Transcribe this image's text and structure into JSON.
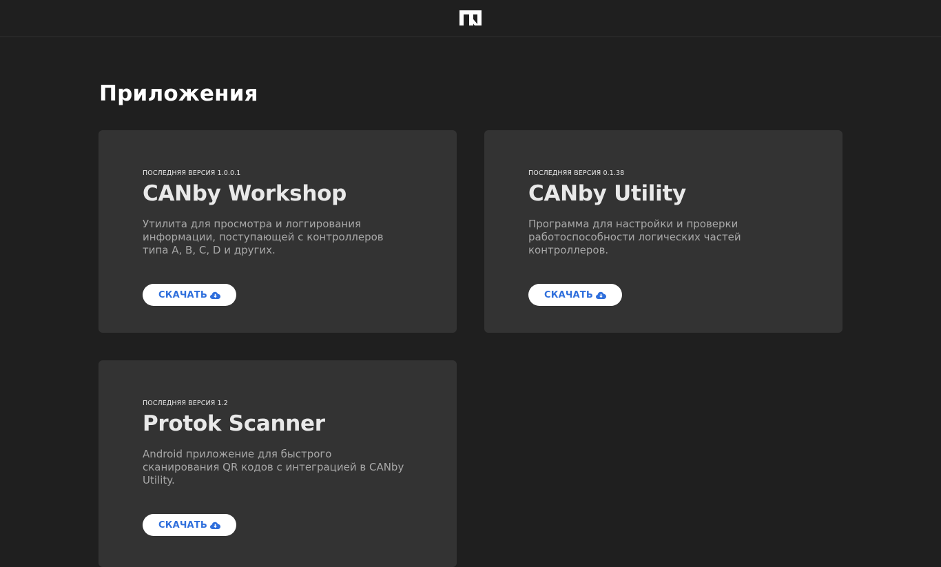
{
  "header": {
    "logo_icon": "protok-logo-icon"
  },
  "page": {
    "title": "Приложения"
  },
  "colors": {
    "background": "#1f1f1f",
    "card": "#333333",
    "accent": "#2f6fdc"
  },
  "apps": [
    {
      "version": "ПОСЛЕДНЯЯ ВЕРСИЯ 1.0.0.1",
      "name": "CANby Workshop",
      "description": "Утилита для просмотра и логгирования информации, поступающей с контроллеров типа A, B, C, D и других.",
      "button_label": "СКАЧАТЬ",
      "button_icon": "cloud-download-icon"
    },
    {
      "version": "ПОСЛЕДНЯЯ ВЕРСИЯ 0.1.38",
      "name": "CANby Utility",
      "description": "Программа для настройки и проверки работоспособности логических частей контроллеров.",
      "button_label": "СКАЧАТЬ",
      "button_icon": "cloud-download-icon"
    },
    {
      "version": "ПОСЛЕДНЯЯ ВЕРСИЯ 1.2",
      "name": "Protok Scanner",
      "description": "Android приложение для быстрого сканирования QR кодов с интеграцией в CANby Utility.",
      "button_label": "СКАЧАТЬ",
      "button_icon": "cloud-download-icon"
    }
  ]
}
